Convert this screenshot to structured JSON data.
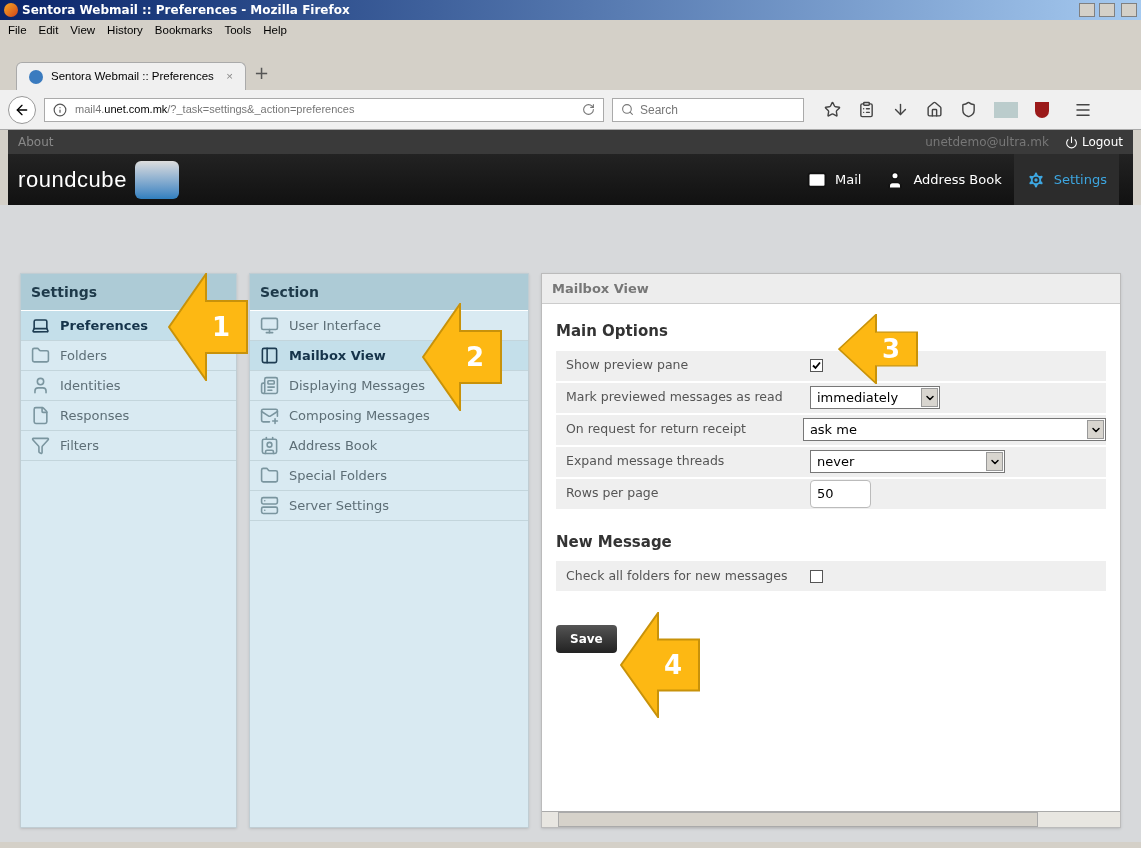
{
  "browser": {
    "title": "Sentora Webmail :: Preferences - Mozilla Firefox",
    "menu": [
      "File",
      "Edit",
      "View",
      "History",
      "Bookmarks",
      "Tools",
      "Help"
    ],
    "tab": {
      "title": "Sentora Webmail :: Preferences",
      "close": "×"
    },
    "new_tab": "+",
    "url": "mail4.**unet.com.mk**/?_task=settings&_action=preferences",
    "search": {
      "placeholder": "Search"
    }
  },
  "app": {
    "about": "About",
    "user": "unetdemo@ultra.mk",
    "logout": "Logout",
    "logo": "roundcube",
    "nav": [
      {
        "label": "Mail",
        "selected": false
      },
      {
        "label": "Address Book",
        "selected": false
      },
      {
        "label": "Settings",
        "selected": true
      }
    ]
  },
  "settings_panel": {
    "title": "Settings",
    "items": [
      {
        "label": "Preferences",
        "selected": true
      },
      {
        "label": "Folders",
        "selected": false
      },
      {
        "label": "Identities",
        "selected": false
      },
      {
        "label": "Responses",
        "selected": false
      },
      {
        "label": "Filters",
        "selected": false
      }
    ]
  },
  "section_panel": {
    "title": "Section",
    "items": [
      {
        "label": "User Interface",
        "selected": false
      },
      {
        "label": "Mailbox View",
        "selected": true
      },
      {
        "label": "Displaying Messages",
        "selected": false
      },
      {
        "label": "Composing Messages",
        "selected": false
      },
      {
        "label": "Address Book",
        "selected": false
      },
      {
        "label": "Special Folders",
        "selected": false
      },
      {
        "label": "Server Settings",
        "selected": false
      }
    ]
  },
  "main": {
    "title": "Mailbox View",
    "groups": [
      {
        "title": "Main Options",
        "rows": [
          {
            "label": "Show preview pane",
            "kind": "checkbox",
            "checked": true
          },
          {
            "label": "Mark previewed messages as read",
            "kind": "select",
            "value": "immediately"
          },
          {
            "label": "On request for return receipt",
            "kind": "select",
            "value": "ask me"
          },
          {
            "label": "Expand message threads",
            "kind": "select",
            "value": "never"
          },
          {
            "label": "Rows per page",
            "kind": "text",
            "value": "50"
          }
        ]
      },
      {
        "title": "New Message",
        "rows": [
          {
            "label": "Check all folders for new messages",
            "kind": "checkbox",
            "checked": false
          }
        ]
      }
    ],
    "save": "Save"
  },
  "annotations": [
    {
      "number": "1"
    },
    {
      "number": "2"
    },
    {
      "number": "3"
    },
    {
      "number": "4"
    }
  ]
}
